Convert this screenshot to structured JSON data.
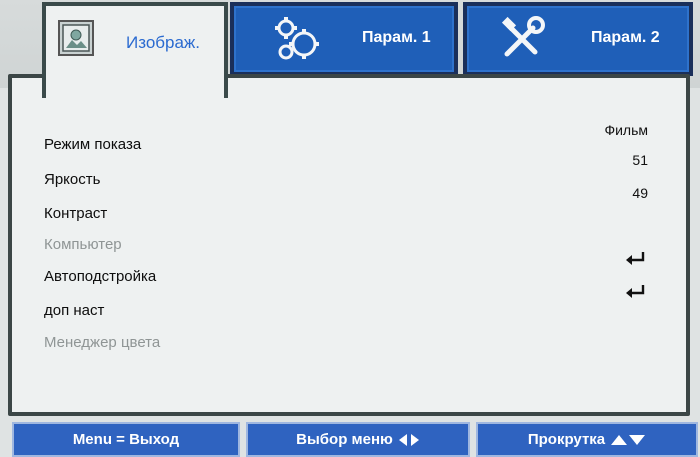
{
  "tabs": [
    {
      "label": "Изображ.",
      "icon": "picture-icon",
      "active": true
    },
    {
      "label": "Парам. 1",
      "icon": "gears-icon",
      "active": false
    },
    {
      "label": "Парам. 2",
      "icon": "tools-icon",
      "active": false
    }
  ],
  "menu": {
    "items": [
      {
        "label": "Режим показа",
        "value": "Фильм"
      },
      {
        "label": "Яркость",
        "value": "51"
      },
      {
        "label": "Контраст",
        "value": "49"
      },
      {
        "label": "Компьютер",
        "value": ""
      },
      {
        "label": "Автоподстройка",
        "value": "enter-icon"
      },
      {
        "label": "доп наст",
        "value": "enter-icon"
      },
      {
        "label": "Менеджер цвета",
        "value": ""
      }
    ]
  },
  "footer": {
    "menu_exit": "Menu = Выход",
    "select_menu": "Выбор меню",
    "scroll": "Прокрутка"
  },
  "colors": {
    "tab_blue": "#1f5fb8",
    "label_blue": "#2a6ad0",
    "footer_blue": "#2f63c0"
  }
}
